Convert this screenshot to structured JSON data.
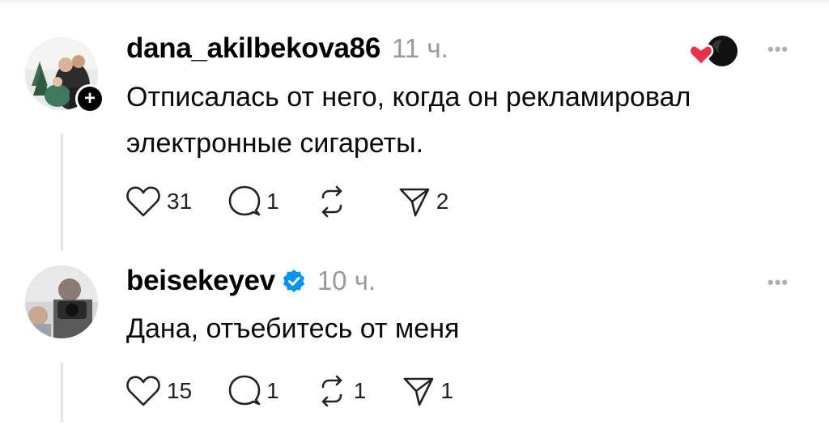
{
  "posts": [
    {
      "username": "dana_akilbekova86",
      "time": "11 ч.",
      "text": "Отписалась от него, когда он рекламировал электронные сигареты.",
      "likes": "31",
      "replies": "1",
      "reposts": "",
      "shares": "2",
      "follow_badge": "+",
      "verified": false
    },
    {
      "username": "beisekeyev",
      "time": "10 ч.",
      "text": "Дана, отъебитесь от меня",
      "likes": "15",
      "replies": "1",
      "reposts": "1",
      "shares": "1",
      "verified": true
    }
  ],
  "more_label": "•••",
  "colors": {
    "like_heart": "#e8334a",
    "verified_blue": "#0095f6",
    "muted": "#9a9a9a"
  },
  "icons": [
    "heart-icon",
    "comment-icon",
    "repost-icon",
    "share-icon",
    "more-icon",
    "verified-icon",
    "plus-icon"
  ]
}
